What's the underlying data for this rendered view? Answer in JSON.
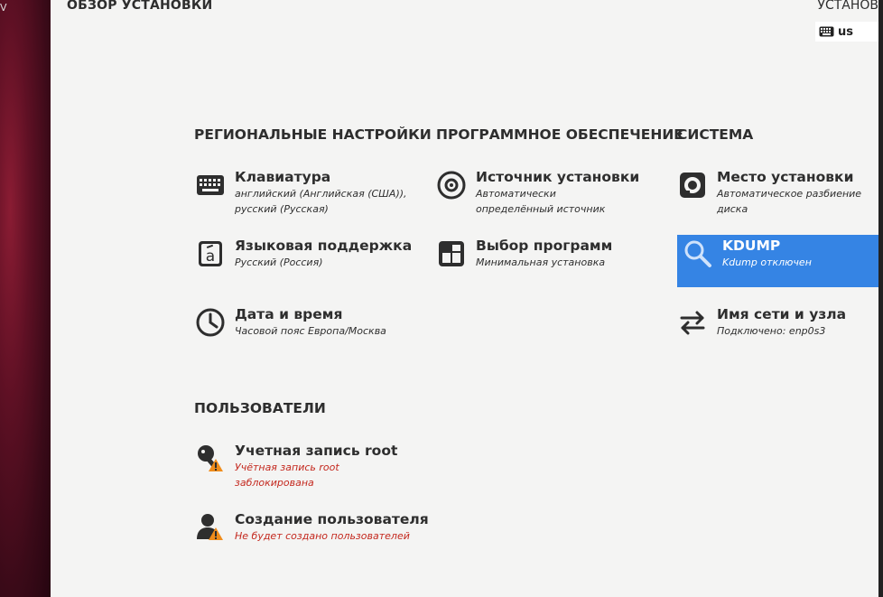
{
  "header": {
    "title": "ОБЗОР УСТАНОВКИ",
    "install_title": "УСТАНОВ",
    "keyboard_layout": "us"
  },
  "sections": {
    "localization": {
      "heading": "РЕГИОНАЛЬНЫЕ НАСТРОЙКИ",
      "keyboard": {
        "title": "Клавиатура",
        "status": "английский (Английская (США)),\nрусский (Русская)"
      },
      "language": {
        "title": "Языковая поддержка",
        "status": "Русский (Россия)"
      },
      "datetime": {
        "title": "Дата и время",
        "status": "Часовой пояс Европа/Москва"
      }
    },
    "software": {
      "heading": "ПРОГРАММНОЕ ОБЕСПЕЧЕНИЕ",
      "source": {
        "title": "Источник установки",
        "status": "Автоматически\nопределённый источник"
      },
      "selection": {
        "title": "Выбор программ",
        "status": "Минимальная установка"
      }
    },
    "system": {
      "heading": "СИСТЕМА",
      "destination": {
        "title": "Место установки",
        "status": "Автоматическое разбиение\nдиска"
      },
      "kdump": {
        "title": "KDUMP",
        "status": "Kdump отключен"
      },
      "network": {
        "title": "Имя сети и узла",
        "status": "Подключено: enp0s3"
      }
    },
    "users": {
      "heading": "ПОЛЬЗОВАТЕЛИ",
      "root": {
        "title": "Учетная запись root",
        "status": "Учётная запись root\nзаблокирована"
      },
      "user": {
        "title": "Создание пользователя",
        "status": "Не будет создано пользователей"
      }
    }
  },
  "colors": {
    "selected": "#3584e4",
    "warning_text": "#c4281e",
    "warning_icon": "#f08c1a",
    "sidebar": "#5e1024"
  },
  "icons": [
    "keyboard-icon",
    "language-icon",
    "clock-icon",
    "install-source-icon",
    "package-icon",
    "disk-icon",
    "search-icon",
    "network-arrows-icon",
    "key-icon",
    "user-icon",
    "warning-icon"
  ]
}
